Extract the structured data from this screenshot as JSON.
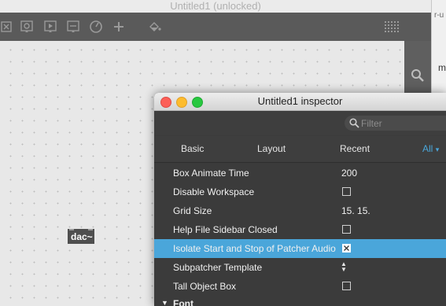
{
  "patcher": {
    "title": "Untitled1 (unlocked)",
    "toolbar_icons": [
      "close-box-icon",
      "message-icon",
      "button-icon",
      "number-icon",
      "dial-icon",
      "add-icon",
      "fill-icon",
      "grid-icon"
    ],
    "right_toolbar_icons": [
      "search-icon"
    ],
    "objects": [
      {
        "label": "dac~"
      }
    ]
  },
  "side_window_text": {
    "line1": "r-u",
    "line2": "m"
  },
  "inspector": {
    "title": "Untitled1 inspector",
    "filter_placeholder": "Filter",
    "tabs": [
      {
        "label": "Basic"
      },
      {
        "label": "Layout"
      },
      {
        "label": "Recent"
      },
      {
        "label": "All"
      }
    ],
    "active_tab": "All",
    "rows": [
      {
        "name": "Box Animate Time",
        "value": "200"
      },
      {
        "name": "Disable Workspace",
        "value": "unchecked"
      },
      {
        "name": "Grid Size",
        "value": "15. 15."
      },
      {
        "name": "Help File Sidebar Closed",
        "value": "unchecked"
      },
      {
        "name": "Isolate Start and Stop of Patcher Audio",
        "value": "checked",
        "selected": true
      },
      {
        "name": "Subpatcher Template",
        "value": "popup"
      },
      {
        "name": "Tall Object Box",
        "value": "unchecked"
      }
    ],
    "section_label": "Font"
  },
  "colors": {
    "selection": "#4aa6da",
    "inspector_bg": "#3b3b3b",
    "toolbar_bg": "#5a5a5a",
    "close": "#fc5f57",
    "minimize": "#fdbc2e",
    "zoom": "#28c840"
  }
}
